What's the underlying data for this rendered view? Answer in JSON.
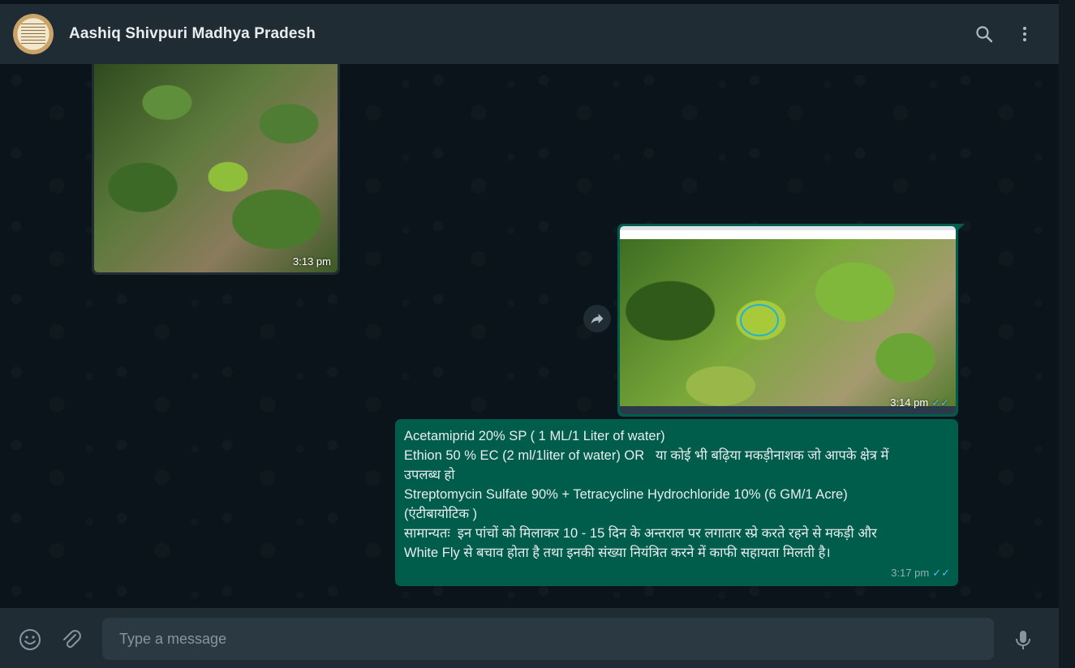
{
  "header": {
    "chat_title": "Aashiq Shivpuri Madhya Pradesh",
    "avatar_icon": "profile-photo-avatar",
    "search_icon": "search-icon",
    "menu_icon": "kebab-menu-icon"
  },
  "messages": [
    {
      "type": "image",
      "direction": "incoming",
      "time": "3:13 pm",
      "image_alt": "photo of papaya plant leaves"
    },
    {
      "type": "image",
      "direction": "outgoing",
      "time": "3:14 pm",
      "status_icon": "double-check-read-icon"
    },
    {
      "type": "text",
      "direction": "outgoing",
      "lines": [
        "Acetamiprid 20% SP ( 1 ML/1 Liter of water)",
        "Ethion 50 % EC (2 ml/1liter of water) OR   या कोई भी बढ़िया मकड़ीनाशक जो आपके क्षेत्र में",
        "उपलब्ध हो",
        "Streptomycin Sulfate 90% + Tetracycline Hydrochloride 10% (6 GM/1 Acre)",
        "(एंटीबायोटिक )",
        "सामान्यतः  इन पांचों को मिलाकर 10 - 15 दिन के अन्तराल पर लगातार स्प्रे करते रहने से मकड़ी और",
        "White Fly से बचाव होता है तथा इनकी संख्या नियंत्रित करने में काफी सहायता मिलती है।"
      ],
      "time": "3:17 pm",
      "status_icon": "double-check-read-icon"
    }
  ],
  "composer": {
    "placeholder": "Type a message",
    "emoji_icon": "emoji-icon",
    "attach_icon": "paperclip-icon",
    "mic_icon": "microphone-icon"
  },
  "colors": {
    "header_bg": "#202c33",
    "chat_bg": "#0b141a",
    "outgoing_bubble": "#005c4b",
    "incoming_bubble": "#202c33",
    "read_ticks": "#53bdeb"
  }
}
